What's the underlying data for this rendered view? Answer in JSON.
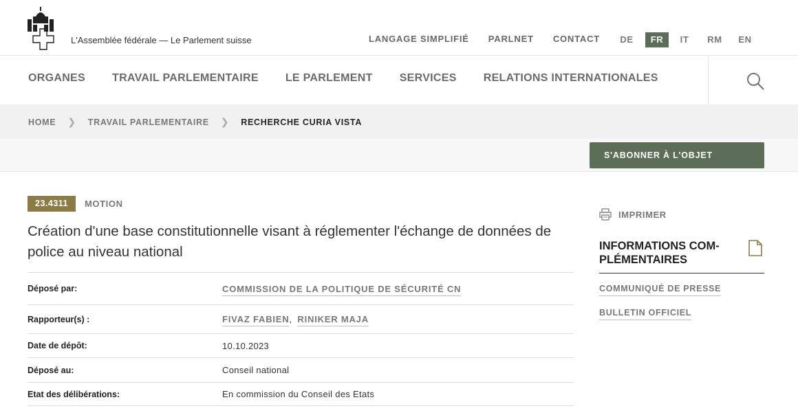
{
  "header": {
    "site_name": "L'Assemblée fédérale — Le Parlement suisse",
    "service_nav": [
      "LANGAGE SIMPLIFIÉ",
      "PARLNET",
      "CONTACT"
    ],
    "languages": [
      {
        "code": "DE",
        "active": false
      },
      {
        "code": "FR",
        "active": true
      },
      {
        "code": "IT",
        "active": false
      },
      {
        "code": "RM",
        "active": false
      },
      {
        "code": "EN",
        "active": false
      }
    ]
  },
  "main_nav": [
    "ORGANES",
    "TRAVAIL PARLEMENTAIRE",
    "LE PARLEMENT",
    "SERVICES",
    "RELATIONS INTERNATIONALES"
  ],
  "breadcrumb": {
    "home": "HOME",
    "level1": "TRAVAIL PARLEMENTAIRE",
    "current": "RECHERCHE CURIA VISTA"
  },
  "subscribe_label": "S'ABONNER À L'OBJET",
  "object": {
    "number": "23.4311",
    "type": "MOTION",
    "title": "Création d'une base constitutionnelle visant à réglementer l'échange de données de police au niveau national"
  },
  "details": {
    "depose_par_label": "Déposé par:",
    "depose_par_value": "COMMISSION DE LA POLITIQUE DE SÉCURITÉ CN",
    "rapporteurs_label": "Rapporteur(s) :",
    "rapporteur_1": "FIVAZ FABIEN",
    "rapporteur_sep": ",",
    "rapporteur_2": "RINIKER MAJA",
    "date_label": "Date de dépôt:",
    "date_value": "10.10.2023",
    "depose_au_label": "Déposé au:",
    "depose_au_value": "Conseil national",
    "etat_label": "Etat des délibérations:",
    "etat_value": "En commission du Conseil des Etats"
  },
  "sidebar": {
    "print_label": "IMPRIMER",
    "info_heading": "INFORMATIONS COM-PLÉMENTAIRES",
    "links": [
      "COMMUNIQUÉ DE PRESSE",
      "BULLETIN OFFICIEL"
    ]
  },
  "colors": {
    "accent_green": "#5d6e58",
    "badge_olive": "#8b7b46"
  }
}
